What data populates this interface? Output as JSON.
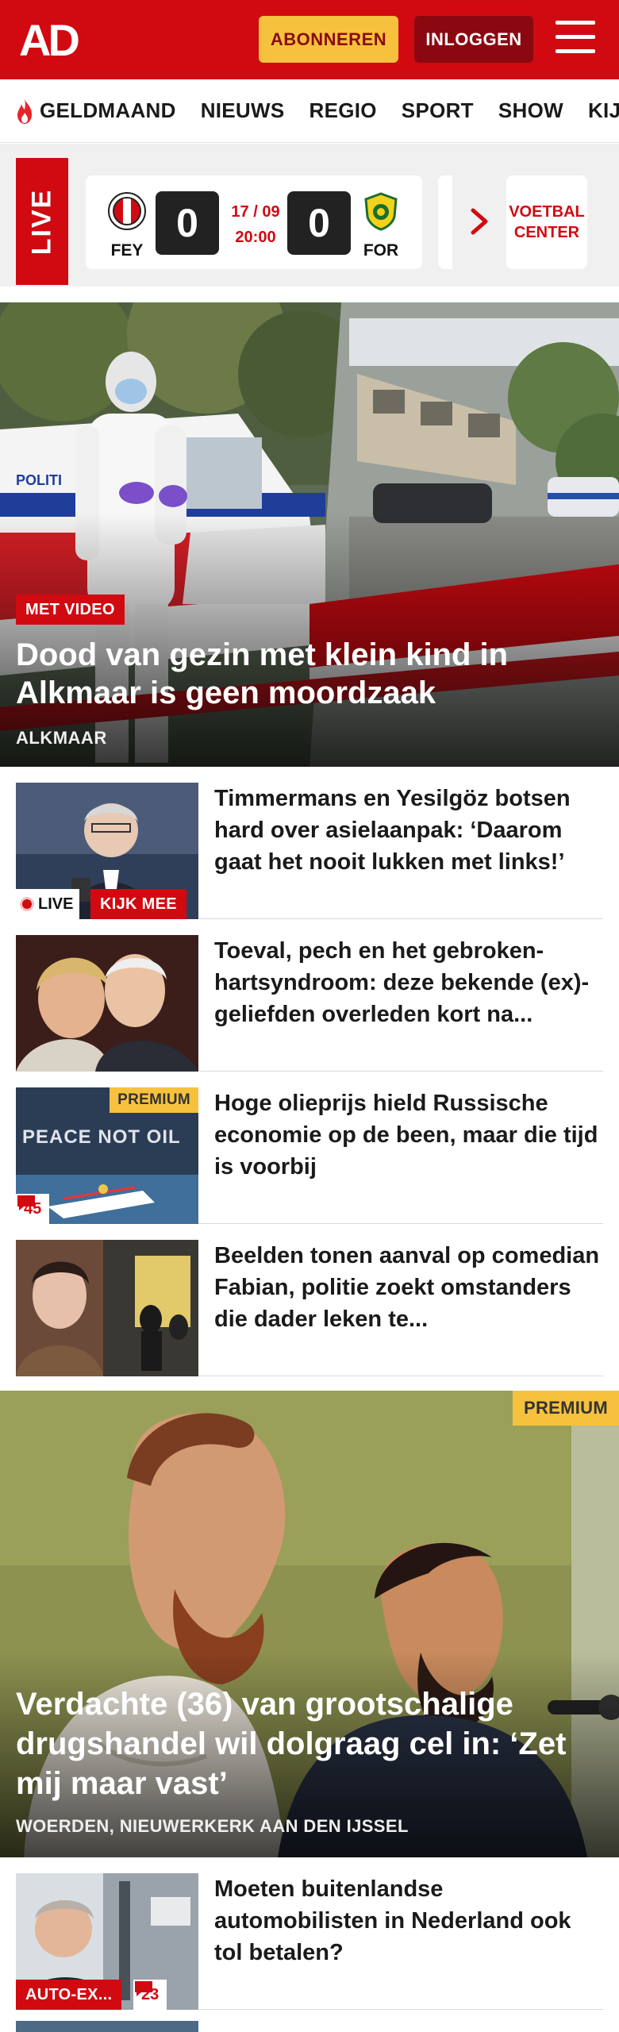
{
  "header": {
    "logo_text": "AD",
    "subscribe_label": "ABONNEREN",
    "login_label": "INLOGGEN",
    "brand_color": "#d10a11",
    "accent_color": "#f6c23e"
  },
  "nav": {
    "items": [
      {
        "label": "GELDMAAND",
        "icon": "flame-icon"
      },
      {
        "label": "NIEUWS"
      },
      {
        "label": "REGIO"
      },
      {
        "label": "SPORT"
      },
      {
        "label": "SHOW"
      },
      {
        "label": "KIJK"
      }
    ]
  },
  "live": {
    "label": "LIVE",
    "match": {
      "home": "FEY",
      "away": "FOR",
      "home_score": "0",
      "away_score": "0",
      "date": "17 / 09",
      "time": "20:00"
    },
    "voetbal_center": "VOETBAL CENTER"
  },
  "hero": {
    "badge": "MET VIDEO",
    "title": "Dood van gezin met klein kind in Alkmaar is geen moordzaak",
    "location": "ALKMAAR"
  },
  "articles": [
    {
      "title": "Timmermans en Yesilgöz botsen hard over asielaanpak: ‘Daarom gaat het nooit lukken met links!’",
      "live_label": "LIVE",
      "watch_label": "KIJK MEE"
    },
    {
      "title": "Toeval, pech en het gebroken-hartsyndroom: deze bekende (ex)-geliefden overleden kort na..."
    },
    {
      "title": "Hoge olieprijs hield Russische economie op de been, maar die tijd is voorbij",
      "premium_label": "PREMIUM",
      "comments": "45",
      "sign_text": "PEACE NOT OIL"
    },
    {
      "title": "Beelden tonen aanval op comedian Fabian, politie zoekt omstanders die dader leken te..."
    }
  ],
  "feature": {
    "premium_label": "PREMIUM",
    "title": "Verdachte (36) van grootschalige drugshandel wil dolgraag cel in: ‘Zet mij maar vast’",
    "location": "WOERDEN, NIEUWERKERK AAN DEN IJSSEL"
  },
  "articles2": [
    {
      "title": "Moeten buitenlandse automobilisten in Nederland ook tol betalen?",
      "tag_label": "AUTO-EX...",
      "comments": "23"
    }
  ]
}
